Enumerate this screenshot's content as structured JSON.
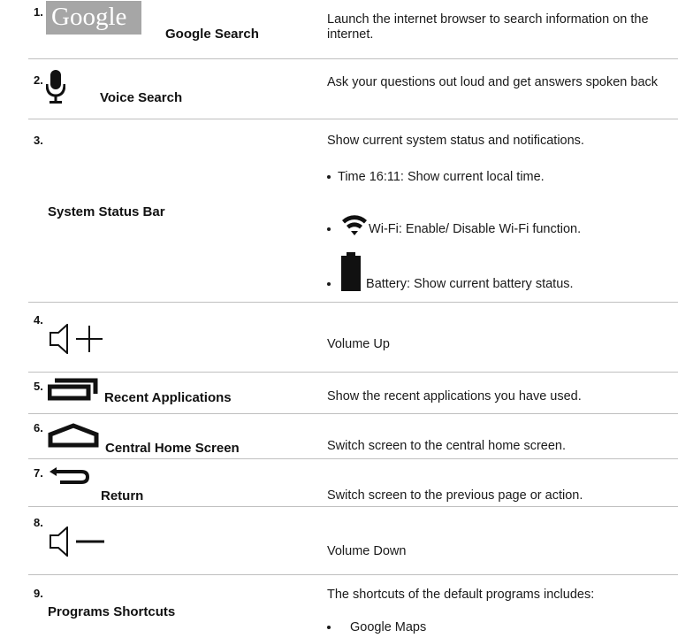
{
  "rows": [
    {
      "num": "1.",
      "logo_text": "Google",
      "name": "Google Search",
      "desc": "Launch the internet browser to search information on the internet.",
      "icon": "google-logo"
    },
    {
      "num": "2.",
      "name": "Voice Search",
      "desc": "Ask your questions out loud and get answers spoken back",
      "icon": "microphone-icon"
    },
    {
      "num": "3.",
      "name": "System Status Bar",
      "desc": "Show current system status and notifications.",
      "bullets": [
        "Time 16:11: Show current local time.",
        "Wi-Fi: Enable/ Disable Wi-Fi function.",
        "Battery: Show current battery status."
      ],
      "icons": [
        "wifi-icon",
        "battery-icon"
      ]
    },
    {
      "num": "4.",
      "name": "",
      "desc": "Volume Up",
      "icon": "volume-up-icon"
    },
    {
      "num": "5.",
      "name": "Recent Applications",
      "desc": "Show the recent applications you have used.",
      "icon": "recent-apps-icon"
    },
    {
      "num": "6.",
      "name": "Central Home Screen",
      "desc": "Switch screen to the central home screen.",
      "icon": "home-icon"
    },
    {
      "num": "7.",
      "name": "Return",
      "desc": "Switch screen to the previous page or action.",
      "icon": "back-icon"
    },
    {
      "num": "8.",
      "name": "",
      "desc": "Volume Down",
      "icon": "volume-down-icon"
    },
    {
      "num": "9.",
      "name": "Programs Shortcuts",
      "desc": "The shortcuts of the default programs includes:",
      "bullets": [
        "Google Maps"
      ]
    }
  ],
  "colors": {
    "text": "#1a1a1a",
    "divider": "#bfbfbf",
    "logo_bg": "#a6a6a6"
  }
}
